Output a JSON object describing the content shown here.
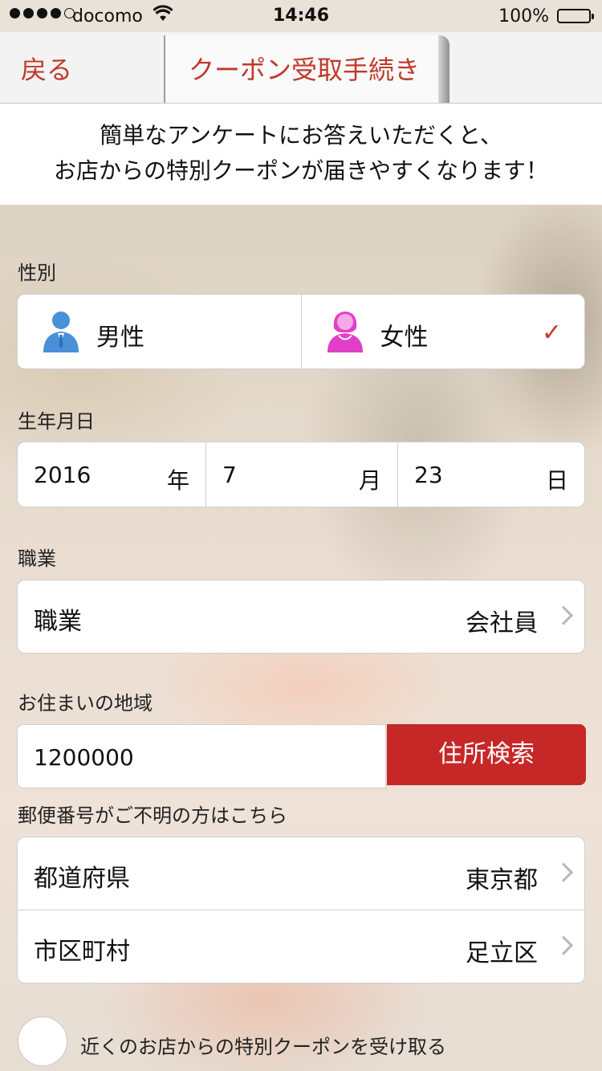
{
  "status": {
    "carrier": "docomo",
    "time": "14:46",
    "battery": "100%"
  },
  "nav": {
    "back": "戻る",
    "title": "クーポン受取手続き"
  },
  "intro": {
    "line1": "簡単なアンケートにお答えいただくと、",
    "line2": "お店からの特別クーポンが届きやすくなります！"
  },
  "gender": {
    "label": "性別",
    "male": "男性",
    "female": "女性",
    "selected": "female",
    "check": "✓",
    "male_color": "#4a90d9",
    "female_color": "#e040c8"
  },
  "birth": {
    "label": "生年月日",
    "year": "2016",
    "year_unit": "年",
    "month": "7",
    "month_unit": "月",
    "day": "23",
    "day_unit": "日"
  },
  "job": {
    "label": "職業",
    "key": "職業",
    "value": "会社員"
  },
  "region": {
    "label": "お住まいの地域",
    "postal_code": "1200000",
    "search_button": "住所検索",
    "help": "郵便番号がご不明の方はこちら",
    "prefecture_key": "都道府県",
    "prefecture_value": "東京都",
    "city_key": "市区町村",
    "city_value": "足立区"
  },
  "agree": {
    "text": "近くのお店からの特別クーポンを受け取る"
  },
  "colors": {
    "accent": "#c0392b",
    "button": "#c62828"
  }
}
